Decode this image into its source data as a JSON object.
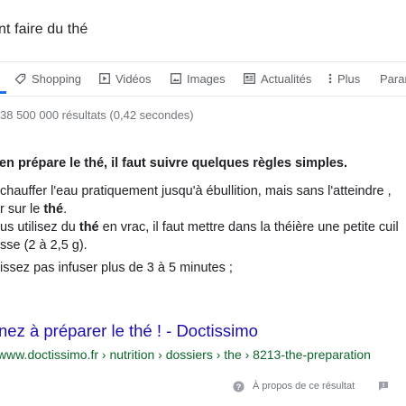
{
  "search": {
    "query_visible": "nt faire du thé"
  },
  "tabs": [
    {
      "label": "Shopping",
      "icon": "tag-icon"
    },
    {
      "label": "Vidéos",
      "icon": "play-icon"
    },
    {
      "label": "Images",
      "icon": "image-icon"
    },
    {
      "label": "Actualités",
      "icon": "news-icon"
    },
    {
      "label": "Plus",
      "icon": "more-vert-icon"
    },
    {
      "label": "Param",
      "icon": ""
    }
  ],
  "stats": "38 500 000 résultats (0,42 secondes)",
  "snippet": {
    "title": "en prépare le thé, il faut suivre quelques règles simples.",
    "lines": [
      {
        "pre": " chauffer l'eau pratiquement jusqu'à ébullition, mais sans l'atteindre ,",
        "bold": "",
        "post": ""
      },
      {
        "pre": "r sur le ",
        "bold": "thé",
        "post": "."
      },
      {
        "pre": "us utilisez du ",
        "bold": "thé",
        "post": " en vrac, il faut mettre dans la théière une petite cuil"
      },
      {
        "pre": "sse (2 à 2,5 g).",
        "bold": "",
        "post": ""
      },
      {
        "pre": "issez pas infuser plus de 3 à 5 minutes ;",
        "bold": "",
        "post": ""
      }
    ]
  },
  "result": {
    "title": "nez à préparer le thé ! - Doctissimo",
    "url": "www.doctissimo.fr › nutrition › dossiers › the › 8213-the-preparation"
  },
  "footer": {
    "about": "À propos de ce résultat",
    "feedback_icon": "feedback-icon",
    "help_icon": "help-circle-icon"
  },
  "colors": {
    "link": "#1a0dab",
    "url": "#0d652d",
    "accent": "#1a73e8",
    "muted": "#70757a"
  }
}
